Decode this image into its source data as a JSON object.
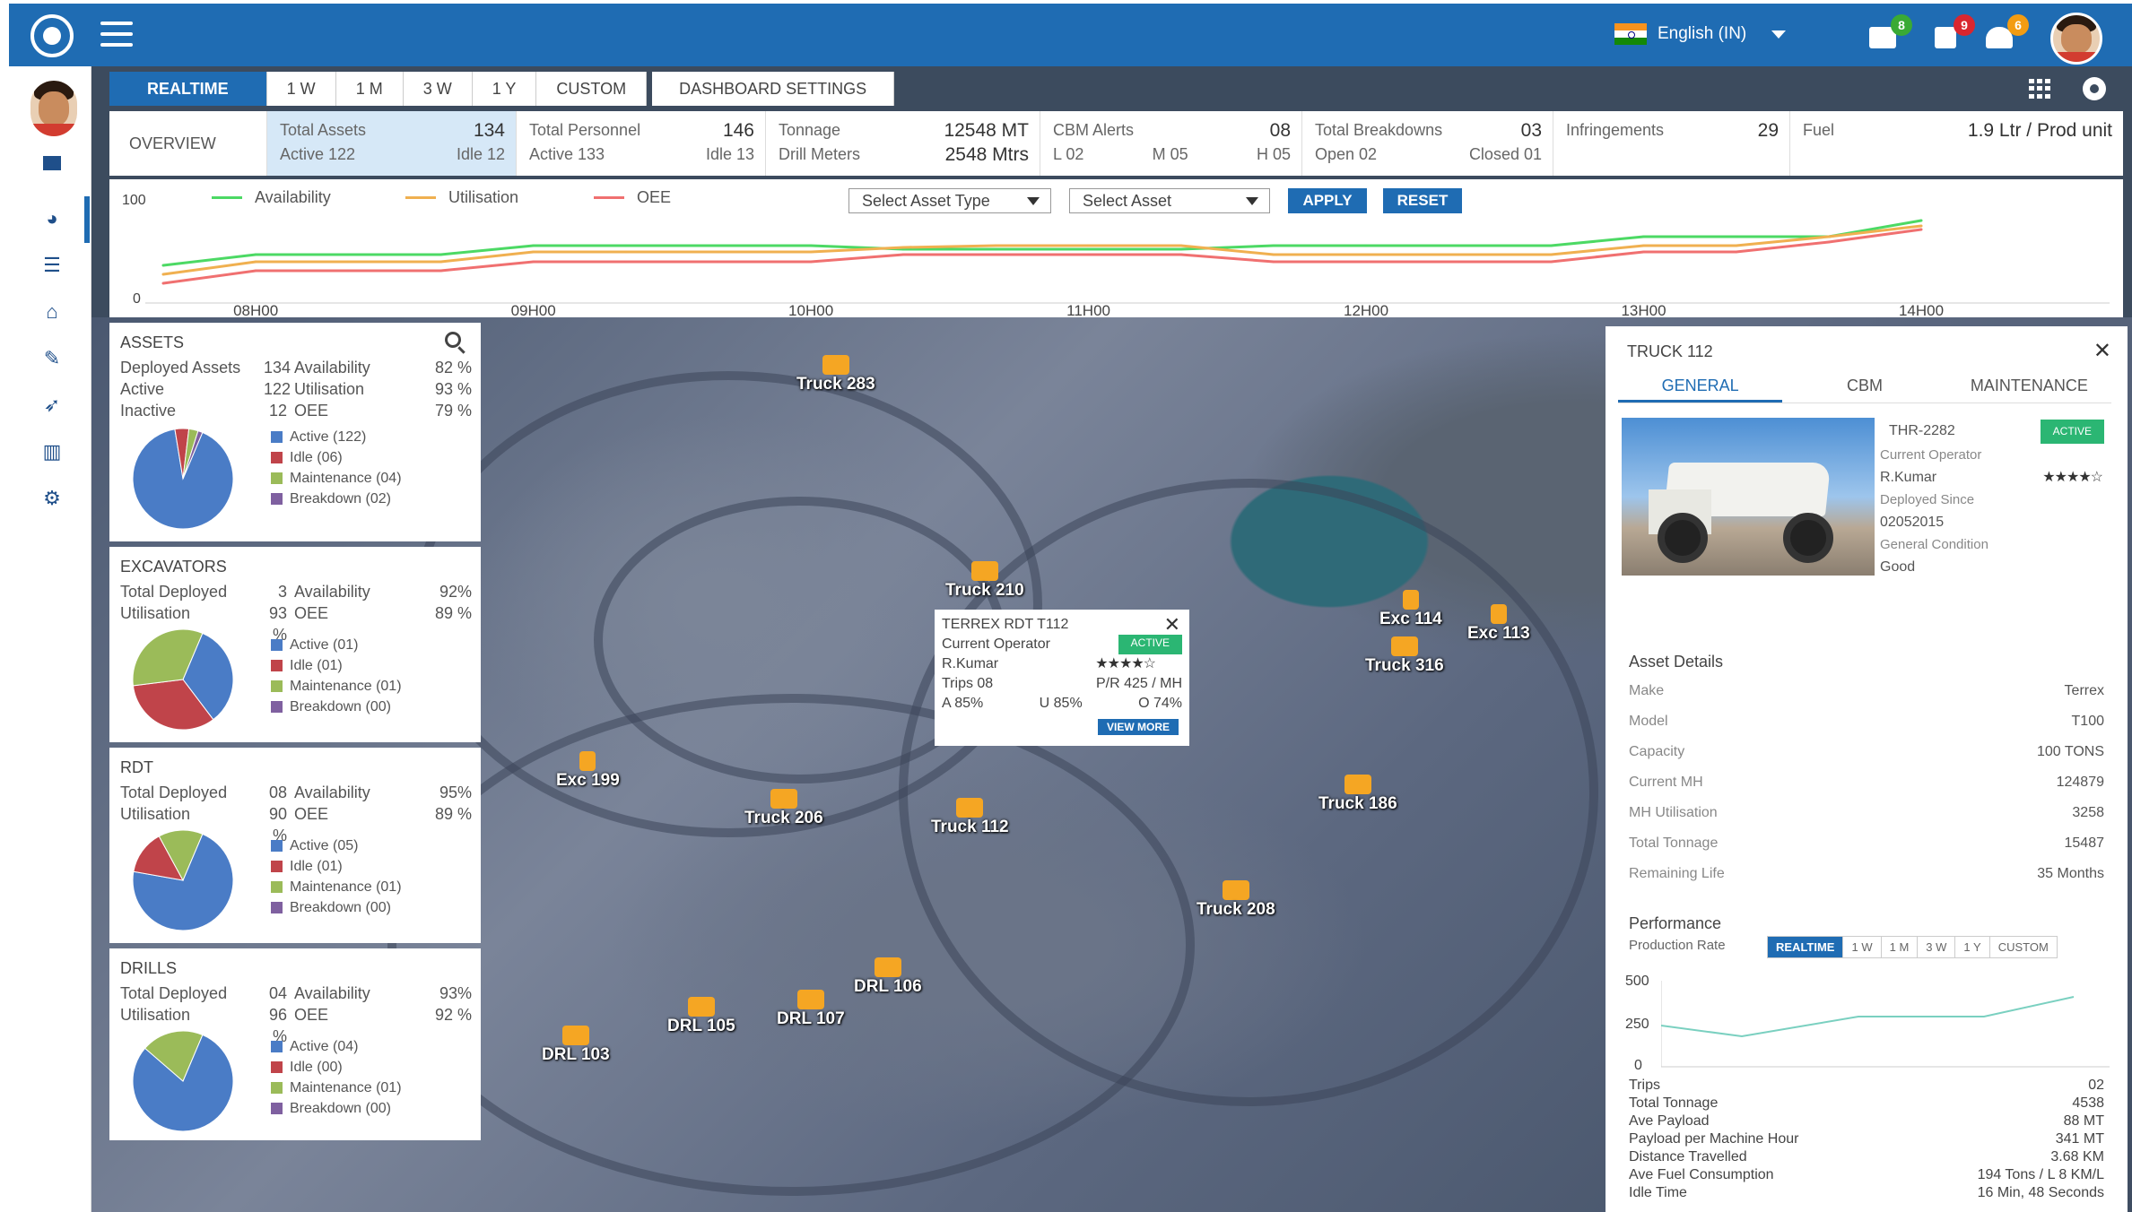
{
  "topbar": {
    "language": "English (IN)",
    "badges": {
      "messages": "8",
      "documents": "9",
      "alerts": "6"
    },
    "colors": {
      "bar": "#1f6cb3",
      "badge_green": "#3aaa35",
      "badge_red": "#d9262f",
      "badge_orange": "#f39c12"
    }
  },
  "time_tabs": [
    "REALTIME",
    "1 W",
    "1 M",
    "3 W",
    "1 Y",
    "CUSTOM"
  ],
  "dashboard_settings": "DASHBOARD SETTINGS",
  "overview": {
    "title": "OVERVIEW",
    "total_assets": {
      "label": "Total Assets",
      "value": "134",
      "active": "Active 122",
      "idle": "Idle 12"
    },
    "total_personnel": {
      "label": "Total Personnel",
      "value": "146",
      "active": "Active 133",
      "idle": "Idle 13"
    },
    "tonnage": {
      "label": "Tonnage",
      "value": "12548 MT",
      "label2": "Drill Meters",
      "value2": "2548 Mtrs"
    },
    "cbm": {
      "label": "CBM Alerts",
      "value": "08",
      "l": "L 02",
      "m": "M 05",
      "h": "H 05"
    },
    "breakdowns": {
      "label": "Total Breakdowns",
      "value": "03",
      "open": "Open 02",
      "closed": "Closed 01"
    },
    "infringements": {
      "label": "Infringements",
      "value": "29"
    },
    "fuel": {
      "label": "Fuel",
      "value": "1.9 Ltr / Prod unit"
    }
  },
  "trend": {
    "legend": [
      "Availability",
      "Utilisation",
      "OEE"
    ],
    "colors": [
      "#4cd964",
      "#f0b050",
      "#f07070"
    ],
    "select_asset_type": "Select Asset Type",
    "select_asset": "Select Asset",
    "apply": "APPLY",
    "reset": "RESET"
  },
  "chart_data": {
    "type": "line",
    "x": [
      "07H40",
      "08H00",
      "08H20",
      "08H40",
      "09H00",
      "09H20",
      "09H40",
      "10H00",
      "10H20",
      "10H40",
      "11H00",
      "11H20",
      "11H40",
      "12H00",
      "12H20",
      "12H40",
      "13H00",
      "13H20",
      "13H40",
      "14H00"
    ],
    "x_ticks": [
      "08H00",
      "09H00",
      "10H00",
      "11H00",
      "12H00",
      "13H00",
      "14H00"
    ],
    "ylim": [
      0,
      100
    ],
    "y_ticks": [
      "100",
      "0"
    ],
    "series": [
      {
        "name": "Availability",
        "values": [
          40,
          52,
          52,
          52,
          62,
          62,
          62,
          62,
          58,
          58,
          58,
          58,
          62,
          62,
          62,
          62,
          72,
          72,
          72,
          90
        ]
      },
      {
        "name": "Utilisation",
        "values": [
          30,
          44,
          44,
          44,
          55,
          55,
          55,
          55,
          60,
          62,
          62,
          62,
          52,
          52,
          52,
          52,
          62,
          62,
          72,
          84
        ]
      },
      {
        "name": "OEE",
        "values": [
          20,
          34,
          34,
          34,
          44,
          44,
          44,
          44,
          52,
          52,
          52,
          52,
          44,
          44,
          44,
          44,
          55,
          55,
          66,
          80
        ]
      }
    ]
  },
  "assets": {
    "title": "ASSETS",
    "rows": [
      [
        "Deployed Assets",
        "134",
        "Availability",
        "82 %"
      ],
      [
        "Active",
        "122",
        "Utilisation",
        "93 %"
      ],
      [
        "Inactive",
        "12",
        "OEE",
        "79 %"
      ]
    ],
    "legend": [
      "Active (122)",
      "Idle (06)",
      "Maintenance (04)",
      "Breakdown (02)"
    ],
    "pie": [
      122,
      6,
      4,
      2
    ]
  },
  "excavators": {
    "title": "EXCAVATORS",
    "rows": [
      [
        "Total Deployed",
        "3",
        "Availability",
        "92%"
      ],
      [
        "Utilisation",
        "93 %",
        "OEE",
        "89 %"
      ]
    ],
    "legend": [
      "Active (01)",
      "Idle (01)",
      "Maintenance (01)",
      "Breakdown (00)"
    ],
    "pie": [
      1,
      1,
      1,
      0
    ]
  },
  "rdt": {
    "title": "RDT",
    "rows": [
      [
        "Total Deployed",
        "08",
        "Availability",
        "95%"
      ],
      [
        "Utilisation",
        "90 %",
        "OEE",
        "89 %"
      ]
    ],
    "legend": [
      "Active (05)",
      "Idle (01)",
      "Maintenance (01)",
      "Breakdown (00)"
    ],
    "pie": [
      5,
      1,
      1,
      0
    ]
  },
  "drills": {
    "title": "DRILLS",
    "rows": [
      [
        "Total Deployed",
        "04",
        "Availability",
        "93%"
      ],
      [
        "Utilisation",
        "96 %",
        "OEE",
        "92 %"
      ]
    ],
    "legend": [
      "Active (04)",
      "Idle (00)",
      "Maintenance (01)",
      "Breakdown (00)"
    ],
    "pie": [
      4,
      0,
      1,
      0
    ]
  },
  "pie_colors": [
    "#4a7cc6",
    "#c0444a",
    "#9bbb59",
    "#7f60a0"
  ],
  "map_markers": [
    "Truck 283",
    "Truck 210",
    "Exc 114",
    "Exc 113",
    "Truck 316",
    "Exc 199",
    "Truck 206",
    "Truck 112",
    "Truck 186",
    "Truck 208",
    "DRL 106",
    "DRL 105",
    "DRL 107",
    "DRL 103"
  ],
  "popup": {
    "title": "TERREX RDT  T112",
    "operator_label": "Current Operator",
    "status": "ACTIVE",
    "operator": "R.Kumar",
    "stars": "★★★★☆",
    "trips": "Trips  08",
    "pr": "P/R  425 / MH",
    "a": "A  85%",
    "u": "U  85%",
    "o": "O  74%",
    "view_more": "VIEW MORE"
  },
  "detail": {
    "title": "TRUCK 112",
    "tabs": [
      "GENERAL",
      "CBM",
      "MAINTENANCE"
    ],
    "id": "THR-2282",
    "status": "ACTIVE",
    "operator_label": "Current Operator",
    "operator": "R.Kumar",
    "stars": "★★★★☆",
    "deployed_label": "Deployed Since",
    "deployed": "02052015",
    "condition_label": "General Condition",
    "condition": "Good",
    "asset_details_title": "Asset Details",
    "asset_details": [
      [
        "Make",
        "Terrex"
      ],
      [
        "Model",
        "T100"
      ],
      [
        "Capacity",
        "100 TONS"
      ],
      [
        "Current MH",
        "124879"
      ],
      [
        "MH Utilisation",
        "3258"
      ],
      [
        "Total Tonnage",
        "15487"
      ],
      [
        "Remaining Life",
        "35 Months"
      ]
    ],
    "performance_title": "Performance",
    "production_rate": "Production Rate",
    "perf_tabs": [
      "REALTIME",
      "1 W",
      "1 M",
      "3 W",
      "1 Y",
      "CUSTOM"
    ],
    "perf_y_ticks": [
      "500",
      "250",
      "0"
    ],
    "stats": [
      [
        "Trips",
        "02"
      ],
      [
        "Total Tonnage",
        "4538"
      ],
      [
        "Ave Payload",
        "88 MT"
      ],
      [
        "Payload per Machine Hour",
        "341 MT"
      ],
      [
        "Distance Travelled",
        "3.68 KM"
      ],
      [
        "Ave Fuel Consumption",
        "194 Tons / L   8 KM/L"
      ],
      [
        "Idle Time",
        "16 Min, 48 Seconds"
      ]
    ]
  }
}
